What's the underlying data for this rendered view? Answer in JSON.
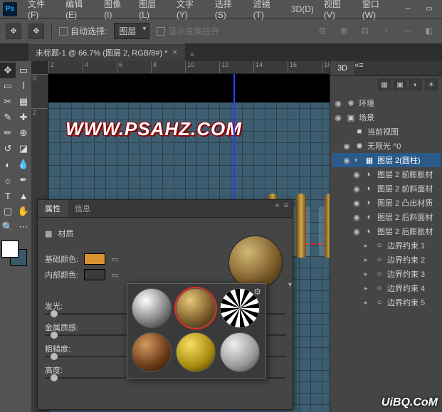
{
  "app": {
    "logo": "Ps"
  },
  "menu": {
    "file": "文件(F)",
    "edit": "编辑(E)",
    "image": "图像(I)",
    "layer": "图层(L)",
    "type": "文字(Y)",
    "select": "选择(S)",
    "filter": "滤镜(T)",
    "three_d": "3D(D)",
    "view": "视图(V)",
    "window": "窗口(W)"
  },
  "optbar": {
    "auto_select_label": "自动选择:",
    "auto_select_value": "图层",
    "show_transform": "显示变换控件"
  },
  "doc": {
    "tab_title": "未标题-1 @ 66.7% (图层 2, RGB/8#) *"
  },
  "ruler_h": [
    "2",
    "4",
    "6",
    "8",
    "10",
    "12",
    "14",
    "16",
    "18"
  ],
  "ruler_v": [
    "0",
    "2"
  ],
  "watermark": "WWW.PSAHZ.COM",
  "watermark2": "UiBQ.CoM",
  "props": {
    "tab_props": "属性",
    "tab_info": "信息",
    "section": "材质",
    "base_color": "基础颜色:",
    "inner_color": "内部颜色:",
    "glow": "发光:",
    "metal": "金属质感:",
    "rough": "粗糙度:",
    "height": "高度:",
    "base_color_hex": "#d8922f",
    "inner_color_hex": "#3a3a3a"
  },
  "panel3d": {
    "title": "3D",
    "env": "环境",
    "scene": "场景",
    "current_view": "当前视图",
    "infinite_light": "无限光 ^0",
    "layer2": "图层 2(圆柱)",
    "items": [
      "图层 2 前膨胀材",
      "图层 2 前斜面材",
      "图层 2 凸出材质",
      "图层 2 后斜面材",
      "图层 2 后膨胀材"
    ],
    "constraints": [
      "边界约束 1",
      "边界约束 2",
      "边界约束 3",
      "边界约束 4",
      "边界约束 5"
    ]
  }
}
